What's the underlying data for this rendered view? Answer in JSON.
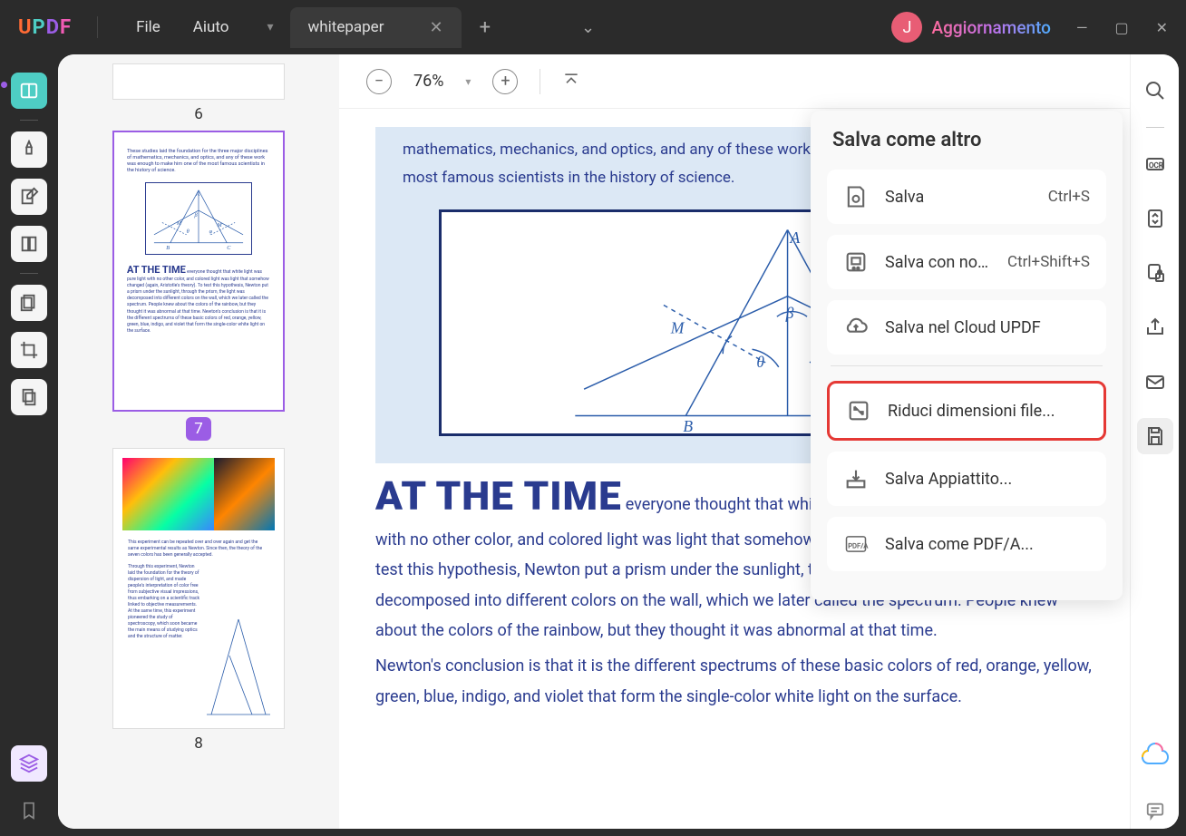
{
  "titlebar": {
    "menu_file": "File",
    "menu_help": "Aiuto",
    "tab_name": "whitepaper",
    "avatar_letter": "J",
    "upgrade_text": "Aggiornamento"
  },
  "thumbnails": {
    "page6_num": "6",
    "page7_num": "7",
    "page8_num": "8",
    "page7_intro": "These studies laid the foundation for the three major disciplines of mathematics, mechanics, and optics, and any of these work was enough to make him one of the most famous scientists in the history of science.",
    "page7_heading": "AT THE TIME",
    "page7_body": "everyone thought that white light was pure light with no other color, and colored light was light that somehow changed (again, Aristotle's theory). To test this hypothesis, Newton put a prism under the sunlight, through the prism, the light was decomposed into different colors on the wall, which we later called the spectrum. People knew about the colors of the rainbow, but they thought it was abnormal at that time. Newton's conclusion is that it is the different spectrums of these basic colors of red, orange, yellow, green, blue, indigo, and violet that form the single-color white light on the surface.",
    "page8_text1": "This experiment can be repeated over and over again and get the same experimental results as Newton. Since then, the theory of the seven colors has been generally accepted.",
    "page8_text2": "Through this experiment, Newton laid the foundation for the theory of dispersion of light, and made people's interpretation of color free from subjective visual impressions, thus embarking on a scientific track linked to objective measurements. At the same time, this experiment pioneered the study of spectroscopy, which soon became the main means of studying optics and the structure of matter."
  },
  "toolbar": {
    "zoom_value": "76%"
  },
  "document": {
    "intro": "mathematics, mechanics, and optics, and any of these work was enough to make him one of the most famous scientists in the history of science.",
    "heading": "AT THE TIME",
    "inline_start": "everyone thought that white light was pure light",
    "body1": "with no other color, and colored light was light that somehow changed (again, Aristotle's theory). To test this hypothesis, Newton put a prism under the sunlight, through the prism, the light was decomposed into different colors on the wall, which we later called the spectrum. People knew about the colors of the rainbow, but they thought it was abnormal at that time.",
    "body2": "Newton's conclusion is that it is the different spectrums of these basic colors of red, orange, yellow, green, blue, indigo, and violet that form the single-color white light on the surface."
  },
  "save_panel": {
    "title": "Salva come altro",
    "save_label": "Salva",
    "save_shortcut": "Ctrl+S",
    "save_as_label": "Salva con nom..",
    "save_as_shortcut": "Ctrl+Shift+S",
    "cloud_label": "Salva nel Cloud UPDF",
    "reduce_label": "Riduci dimensioni file...",
    "flatten_label": "Salva Appiattito...",
    "pdfa_label": "Salva come PDF/A..."
  },
  "diagram": {
    "A": "A",
    "B": "B",
    "C": "C",
    "M": "M",
    "beta": "β",
    "theta": "θ",
    "phi": "φ"
  }
}
